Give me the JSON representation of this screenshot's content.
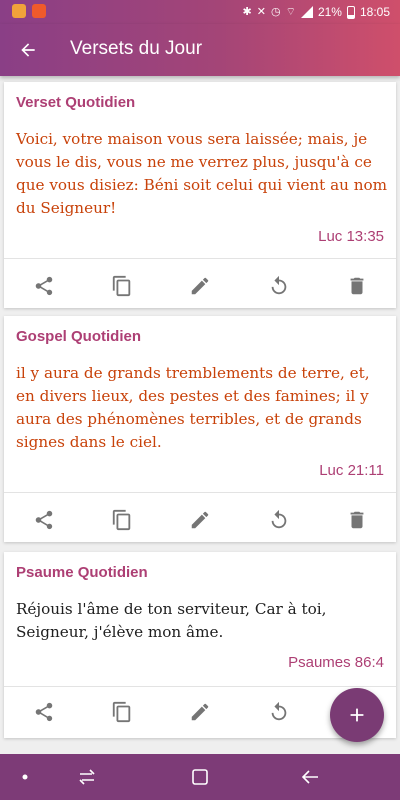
{
  "status_bar": {
    "battery": "21%",
    "time": "18:05"
  },
  "app_bar": {
    "title": "Versets du Jour"
  },
  "cards": [
    {
      "title": "Verset Quotidien",
      "text": "Voici, votre maison vous sera laissée; mais, je vous le dis, vous ne me verrez plus, jusqu'à ce que vous disiez: Béni soit celui qui vient au nom du Seigneur!",
      "reference": "Luc 13:35",
      "text_color": "#c8420a"
    },
    {
      "title": "Gospel Quotidien",
      "text": "il y aura de grands tremblements de terre, et, en divers lieux, des pestes et des famines; il y aura des phénomènes terribles, et de grands signes dans le ciel.",
      "reference": "Luc 21:11",
      "text_color": "#c8420a"
    },
    {
      "title": "Psaume Quotidien",
      "text": "Réjouis l'âme de ton serviteur, Car à toi, Seigneur, j'élève mon âme.",
      "reference": "Psaumes 86:4",
      "text_color": "#202020"
    }
  ],
  "card_actions": [
    "share-icon",
    "copy-icon",
    "edit-icon",
    "refresh-icon",
    "delete-icon"
  ],
  "colors": {
    "app_bar_start": "#8a3f86",
    "app_bar_end": "#cf4f6b",
    "accent": "#ad3f74",
    "fab": "#7a3b74",
    "nav_bar": "#7d3b77"
  }
}
